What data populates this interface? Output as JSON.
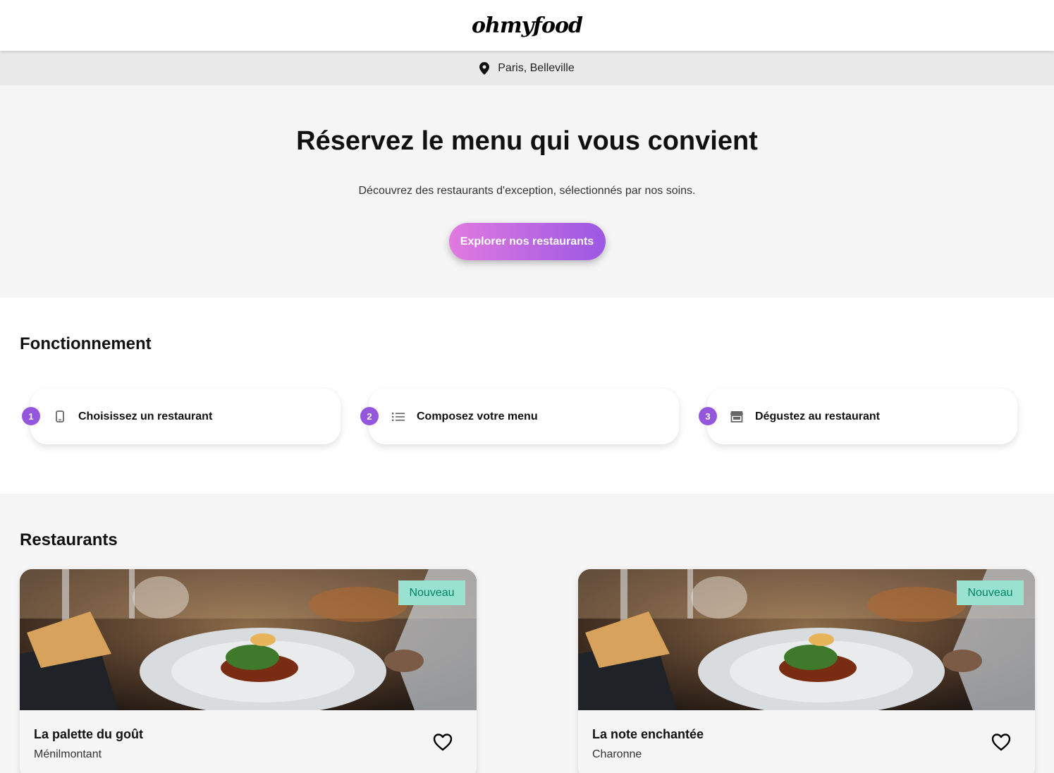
{
  "header": {
    "logo": "ohmyfood"
  },
  "location": {
    "text": "Paris, Belleville",
    "icon": "location-pin-icon"
  },
  "hero": {
    "title": "Réservez le menu qui vous convient",
    "subtitle": "Découvrez des restaurants d'exception, sélectionnés par nos soins.",
    "cta_label": "Explorer nos restaurants",
    "gradient": [
      "#e17ae0",
      "#9b58e3"
    ]
  },
  "how": {
    "title": "Fonctionnement",
    "steps": [
      {
        "number": "1",
        "label": "Choisissez un restaurant",
        "icon": "mobile-phone-icon"
      },
      {
        "number": "2",
        "label": "Composez votre menu",
        "icon": "list-icon"
      },
      {
        "number": "3",
        "label": "Dégustez au restaurant",
        "icon": "store-icon"
      }
    ]
  },
  "restaurants": {
    "title": "Restaurants",
    "items": [
      {
        "name": "La palette du goût",
        "area": "Ménilmontant",
        "badge": "Nouveau"
      },
      {
        "name": "La note enchantée",
        "area": "Charonne",
        "badge": "Nouveau"
      }
    ]
  },
  "colors": {
    "accent": "#9356dc",
    "badge_bg": "#99e2d0",
    "badge_text": "#00835e"
  }
}
